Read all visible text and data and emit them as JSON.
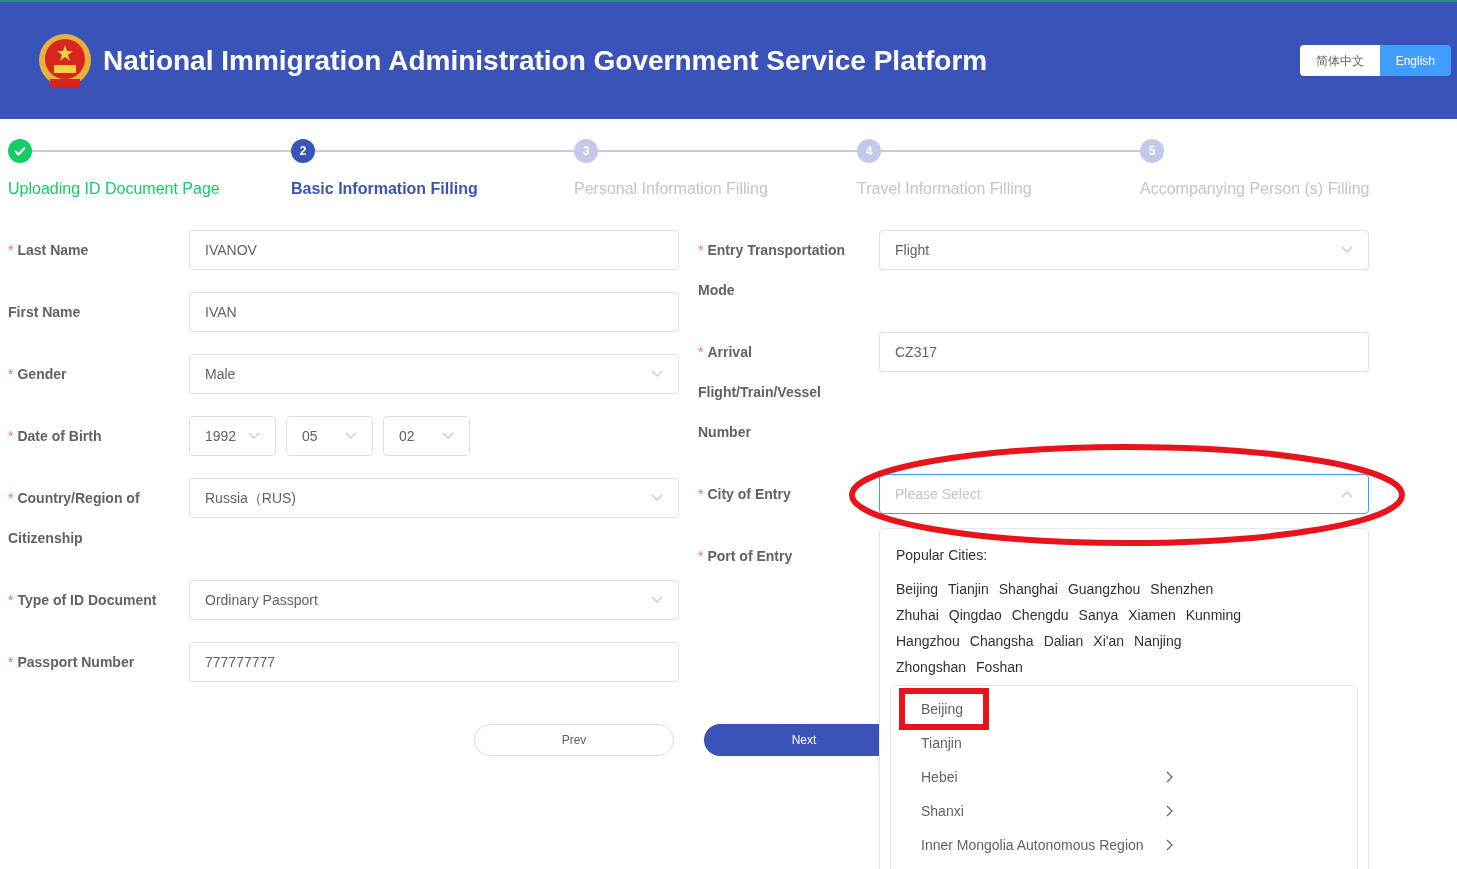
{
  "header": {
    "title": "National Immigration Administration Government Service Platform",
    "languages": [
      {
        "label": "简体中文",
        "selected": false
      },
      {
        "label": "English",
        "selected": true
      }
    ]
  },
  "steps": [
    {
      "label": "Uploading ID Document Page",
      "completed": true,
      "selected": false
    },
    {
      "number": "2",
      "label": "Basic Information Filling",
      "completed": false,
      "selected": true
    },
    {
      "number": "3",
      "label": "Personal Information Filling",
      "completed": false,
      "selected": false
    },
    {
      "number": "4",
      "label": "Travel Information Filling",
      "completed": false,
      "selected": false
    },
    {
      "number": "5",
      "label": "Accompanying Person (s) Filling",
      "completed": false,
      "selected": false
    }
  ],
  "left_fields": [
    {
      "required_mark": "*",
      "label": "Last Name",
      "kind": "text",
      "value": "IVANOV"
    },
    {
      "label": "First Name",
      "kind": "text",
      "value": "IVAN"
    },
    {
      "required_mark": "*",
      "label": "Gender",
      "kind": "select",
      "value": "Male"
    },
    {
      "required_mark": "*",
      "label": "Date of Birth",
      "kind": "date",
      "parts": [
        "1992",
        "05",
        "02"
      ]
    },
    {
      "required_mark": "*",
      "label": "Country/Region of Citizenship",
      "kind": "select",
      "value": "Russia（RUS)"
    },
    {
      "required_mark": "*",
      "label": "Type of ID Document",
      "kind": "select",
      "value": "Ordinary Passport"
    },
    {
      "required_mark": "*",
      "label": "Passport Number",
      "kind": "text",
      "value": "777777777"
    }
  ],
  "right_fields": [
    {
      "required_mark": "*",
      "label": "Entry Transportation Mode",
      "kind": "select",
      "value": "Flight"
    },
    {
      "required_mark": "*",
      "label": "Arrival Flight/Train/Vessel Number",
      "kind": "text",
      "value": "CZ317"
    },
    {
      "required_mark": "*",
      "label": "City of Entry",
      "kind": "select",
      "placeholder": "Please Select",
      "expanded": true
    },
    {
      "required_mark": "*",
      "label": "Port of Entry",
      "kind": "hidden"
    }
  ],
  "buttons": [
    {
      "label": "Prev",
      "kind": "secondary"
    },
    {
      "label": "Next",
      "kind": "primary"
    }
  ],
  "city_popup": {
    "heading": "Popular Cities:",
    "popular_rows": [
      [
        "Beijing",
        "Tianjin",
        "Shanghai",
        "Guangzhou",
        "Shenzhen"
      ],
      [
        "Zhuhai",
        "Qingdao",
        "Chengdu",
        "Sanya",
        "Xiamen",
        "Kunming"
      ],
      [
        "Hangzhou",
        "Changsha",
        "Dalian",
        "Xi'an",
        "Nanjing"
      ],
      [
        "Zhongshan",
        "Foshan"
      ]
    ],
    "regions": [
      {
        "name": "Beijing",
        "expandable": false,
        "marked": true
      },
      {
        "name": "Tianjin",
        "expandable": false,
        "marked": false
      },
      {
        "name": "Hebei",
        "expandable": true,
        "marked": false
      },
      {
        "name": "Shanxi",
        "expandable": true,
        "marked": false
      },
      {
        "name": "Inner Mongolia Autonomous Region",
        "expandable": true,
        "marked": false
      }
    ]
  }
}
